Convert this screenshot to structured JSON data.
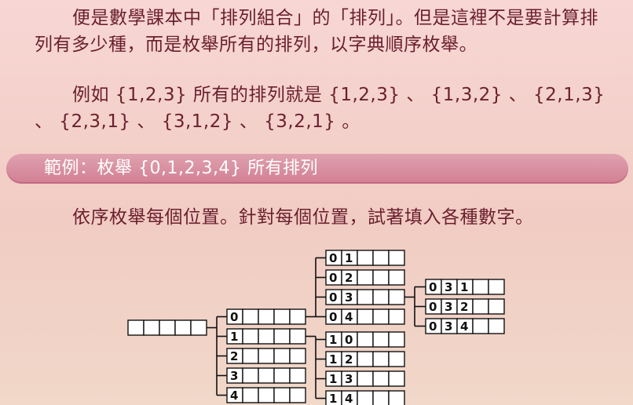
{
  "paragraph1": "便是數學課本中「排列組合」的「排列」。但是這裡不是要計算排列有多少種，而是枚舉所有的排列，以字典順序枚舉。",
  "paragraph2": "例如 {1,2,3} 所有的排列就是 {1,2,3} 、 {1,3,2} 、 {2,1,3} 、 {2,3,1} 、 {3,1,2} 、 {3,2,1} 。",
  "section_title": "範例：枚舉 {0,1,2,3,4} 所有排列",
  "paragraph3": "依序枚舉每個位置。針對每個位置，試著填入各種數字。",
  "diagram": {
    "root": [
      "",
      "",
      "",
      "",
      ""
    ],
    "level1": [
      [
        "0"
      ],
      [
        "1"
      ],
      [
        "2"
      ],
      [
        "3"
      ],
      [
        "4"
      ]
    ],
    "level2_from_0": [
      [
        "0",
        "1"
      ],
      [
        "0",
        "2"
      ],
      [
        "0",
        "3"
      ],
      [
        "0",
        "4"
      ]
    ],
    "level2_from_1": [
      [
        "1",
        "0"
      ],
      [
        "1",
        "2"
      ],
      [
        "1",
        "3"
      ],
      [
        "1",
        "4"
      ]
    ],
    "level3_from_03": [
      [
        "0",
        "3",
        "1"
      ],
      [
        "0",
        "3",
        "2"
      ],
      [
        "0",
        "3",
        "4"
      ]
    ]
  }
}
